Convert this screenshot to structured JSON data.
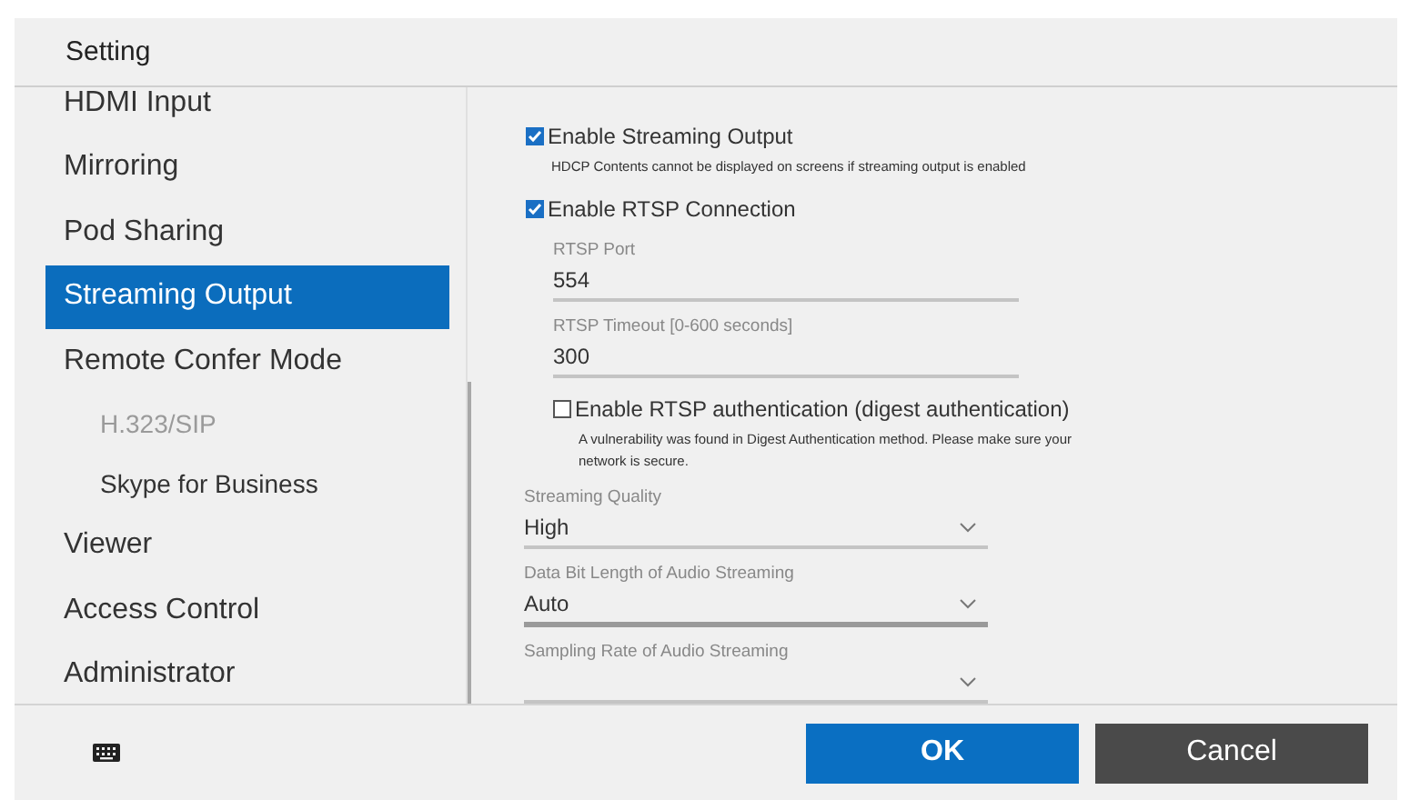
{
  "window": {
    "title": "Setting"
  },
  "sidebar": {
    "items": [
      {
        "label": "HDMI Input",
        "selected": false
      },
      {
        "label": "Mirroring",
        "selected": false
      },
      {
        "label": "Pod Sharing",
        "selected": false
      },
      {
        "label": "Streaming Output",
        "selected": true
      },
      {
        "label": "Remote Confer Mode",
        "selected": false,
        "children": [
          {
            "label": "H.323/SIP",
            "selected": false,
            "disabled": true
          },
          {
            "label": "Skype for Business",
            "selected": false,
            "disabled": false
          }
        ]
      },
      {
        "label": "Viewer",
        "selected": false
      },
      {
        "label": "Access Control",
        "selected": false
      },
      {
        "label": "Administrator",
        "selected": false
      }
    ]
  },
  "content": {
    "items": [
      {
        "kind": "checkbox",
        "label": "Enable Streaming Output",
        "checked": true,
        "note": "HDCP Contents cannot be displayed on screens if streaming output is enabled"
      },
      {
        "kind": "checkbox",
        "label": "Enable RTSP Connection",
        "checked": true,
        "children": [
          {
            "kind": "text_field",
            "label": "RTSP Port",
            "value": "554"
          },
          {
            "kind": "text_field",
            "label": "RTSP Timeout [0-600 seconds]",
            "value": "300"
          },
          {
            "kind": "checkbox",
            "label": "Enable RTSP authentication (digest authentication)",
            "checked": false,
            "note": "A vulnerability was found in Digest Authentication method. Please make sure your network is secure."
          }
        ]
      },
      {
        "kind": "dropdown",
        "label": "Streaming Quality",
        "value": "High",
        "focused": false
      },
      {
        "kind": "dropdown",
        "label": "Data Bit Length of Audio Streaming",
        "value": "Auto",
        "focused": true
      },
      {
        "kind": "dropdown",
        "label": "Sampling Rate of Audio Streaming",
        "focused": false
      }
    ]
  },
  "footer": {
    "buttons": [
      {
        "label": "OK",
        "kind": "primary"
      },
      {
        "label": "Cancel",
        "kind": "secondary"
      }
    ]
  }
}
